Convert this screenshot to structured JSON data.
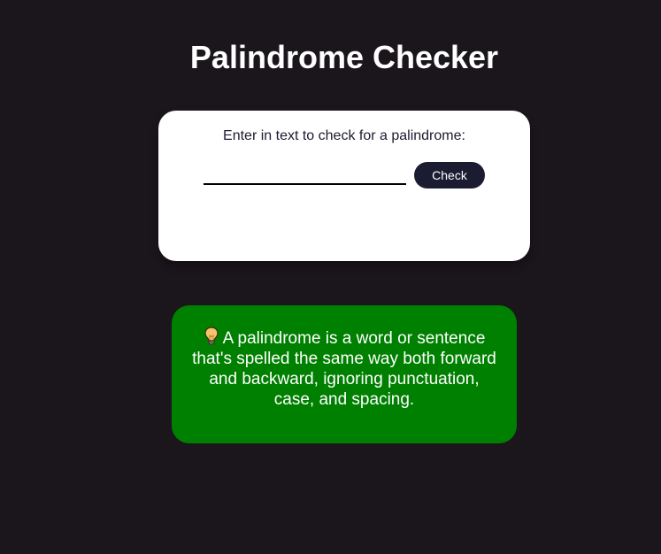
{
  "header": {
    "title": "Palindrome Checker"
  },
  "checker": {
    "label": "Enter in text to check for a palindrome:",
    "input_value": "",
    "input_placeholder": "",
    "button_label": "Check"
  },
  "info": {
    "icon": "lightbulb-icon",
    "text": "A palindrome is a word or sentence that's spelled the same way both forward and backward, ignoring punctuation, case, and spacing."
  },
  "colors": {
    "background": "#1b161c",
    "card": "#ffffff",
    "button": "#1b1b32",
    "info_box": "#008000",
    "bulb": "#f5c56a"
  }
}
